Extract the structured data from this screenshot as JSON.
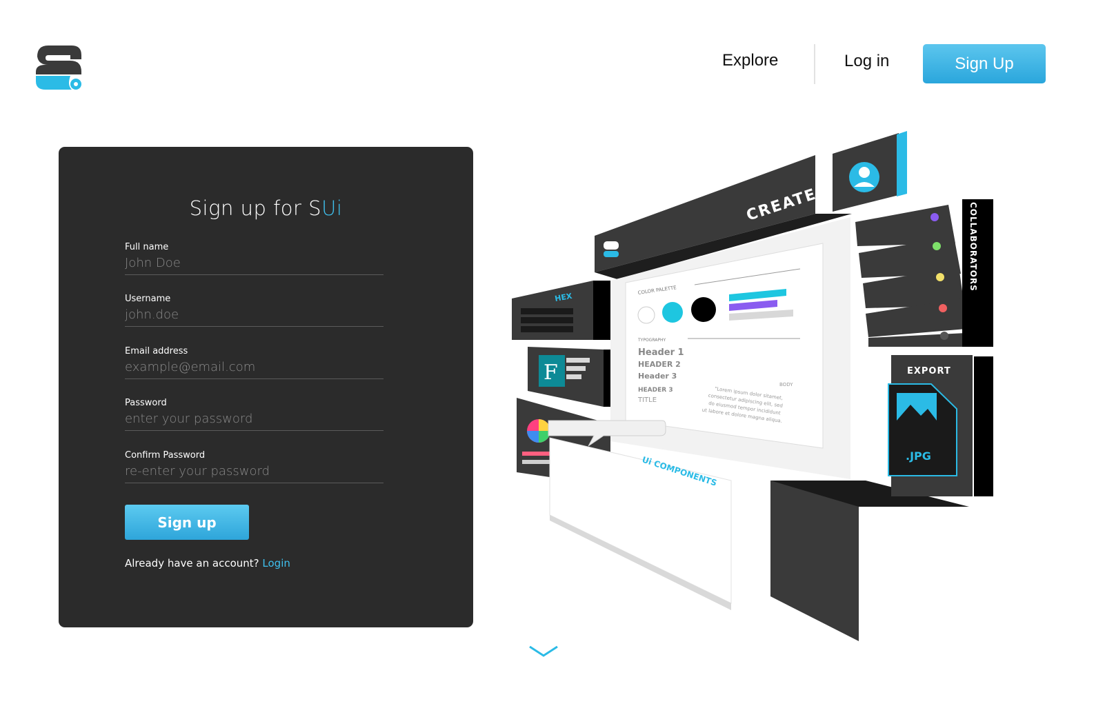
{
  "header": {
    "nav": {
      "explore": "Explore",
      "login": "Log in",
      "signup": "Sign Up"
    }
  },
  "form": {
    "title_prefix": "Sign up for S",
    "title_accent": "Ui",
    "fields": [
      {
        "label": "Full name",
        "placeholder": "John Doe"
      },
      {
        "label": "Username",
        "placeholder": "john.doe"
      },
      {
        "label": "Email address",
        "placeholder": "example@email.com"
      },
      {
        "label": "Password",
        "placeholder": "enter your password"
      },
      {
        "label": "Confirm Password",
        "placeholder": "re-enter your password"
      }
    ],
    "submit": "Sign up",
    "already_text": "Already have an account?",
    "login_link": "Login"
  },
  "illustration": {
    "create": "CREATE",
    "collaborators": "COLLABORATORS",
    "hex": "HEX",
    "export": "EXPORT",
    "jpg": ".JPG",
    "ui_components": "Ui COMPONENTS",
    "color_palette": "COLOR PALETTE",
    "typography": "TYPOGRAPHY",
    "header1": "Header 1",
    "header2": "HEADER 2",
    "header3a": "Header 3",
    "header3b": "HEADER 3",
    "title": "TITLE",
    "body": "BODY",
    "lorem1": "\"Lorem ipsum dolor sitamet,",
    "lorem2": "consectetur adipiscing elit, sed",
    "lorem3": "do eiusmod tempor incididunt",
    "lorem4": "ut labore et dolore magna aliqua.",
    "font_letter": "F"
  },
  "colors": {
    "accent": "#3fc0ee",
    "card_bg": "#2b2b2b",
    "purple": "#8a5cf0",
    "green": "#7ee06a",
    "yellow": "#f2e06a",
    "red": "#f06060"
  },
  "icons": {
    "logo": "sui-logo",
    "scroll": "chevron-down-icon"
  }
}
